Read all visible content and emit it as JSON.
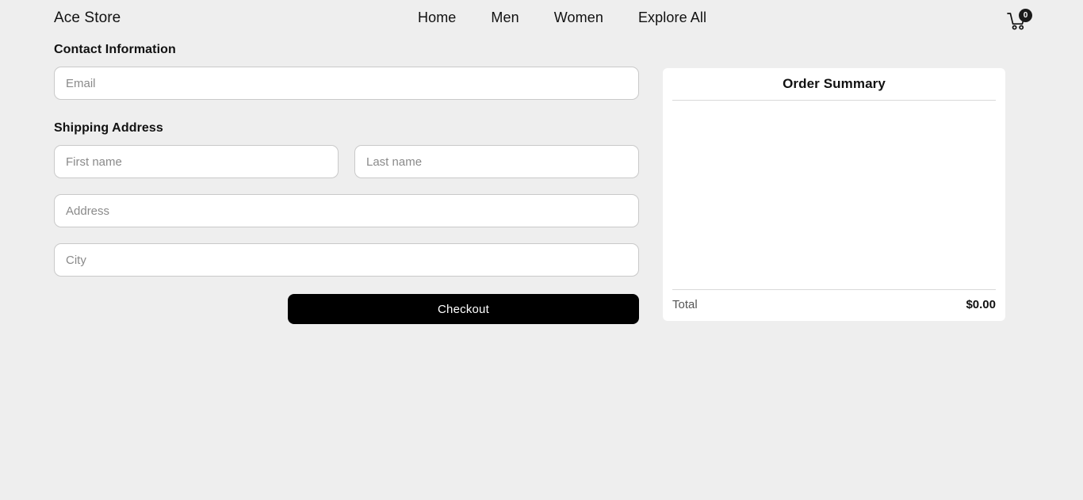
{
  "page": {
    "background_color": "#eeeeee"
  },
  "header": {
    "brand": "Ace Store",
    "nav": [
      {
        "label": "Home"
      },
      {
        "label": "Men"
      },
      {
        "label": "Women"
      },
      {
        "label": "Explore All"
      }
    ],
    "cart": {
      "icon": "shopping-cart-icon",
      "count": "0",
      "badge_color": "#1a1a1a"
    }
  },
  "checkout_form": {
    "contact_section_title": "Contact Information",
    "email": {
      "placeholder": "Email",
      "value": ""
    },
    "shipping_section_title": "Shipping Address",
    "first_name": {
      "placeholder": "First name",
      "value": ""
    },
    "last_name": {
      "placeholder": "Last name",
      "value": ""
    },
    "address": {
      "placeholder": "Address",
      "value": ""
    },
    "city": {
      "placeholder": "City",
      "value": ""
    },
    "submit_label": "Checkout",
    "submit_color": "#000000"
  },
  "order_summary": {
    "title": "Order Summary",
    "items": [],
    "total_label": "Total",
    "total_value": "$0.00"
  }
}
